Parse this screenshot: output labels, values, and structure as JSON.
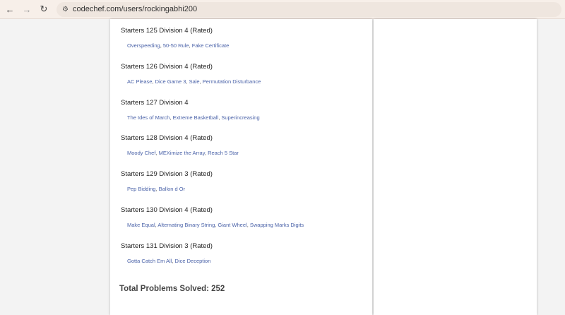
{
  "browser": {
    "url": "codechef.com/users/rockingabhi200"
  },
  "contests": [
    {
      "title": "Starters 125 Division 4 (Rated)",
      "problems": [
        "Overspeeding",
        "50-50 Rule",
        "Fake Certificate"
      ]
    },
    {
      "title": "Starters 126 Division 4 (Rated)",
      "problems": [
        "AC Please",
        "Dice Game 3",
        "Sale",
        "Permutation Disturbance"
      ]
    },
    {
      "title": "Starters 127 Division 4",
      "problems": [
        "The Ides of March",
        "Extreme Basketball",
        "Superincreasing"
      ]
    },
    {
      "title": "Starters 128 Division 4 (Rated)",
      "problems": [
        "Moody Chef",
        "MEXimize the Array",
        "Reach 5 Star"
      ]
    },
    {
      "title": "Starters 129 Division 3 (Rated)",
      "problems": [
        "Pep Bidding",
        "Ballon d Or"
      ]
    },
    {
      "title": "Starters 130 Division 4 (Rated)",
      "problems": [
        "Make Equal",
        "Alternating Binary String",
        "Giant Wheel",
        "Swapping Marks Digits"
      ]
    },
    {
      "title": "Starters 131 Division 3 (Rated)",
      "problems": [
        "Gotta Catch Em All",
        "Dice Deception"
      ]
    }
  ],
  "total": "Total Problems Solved: 252"
}
